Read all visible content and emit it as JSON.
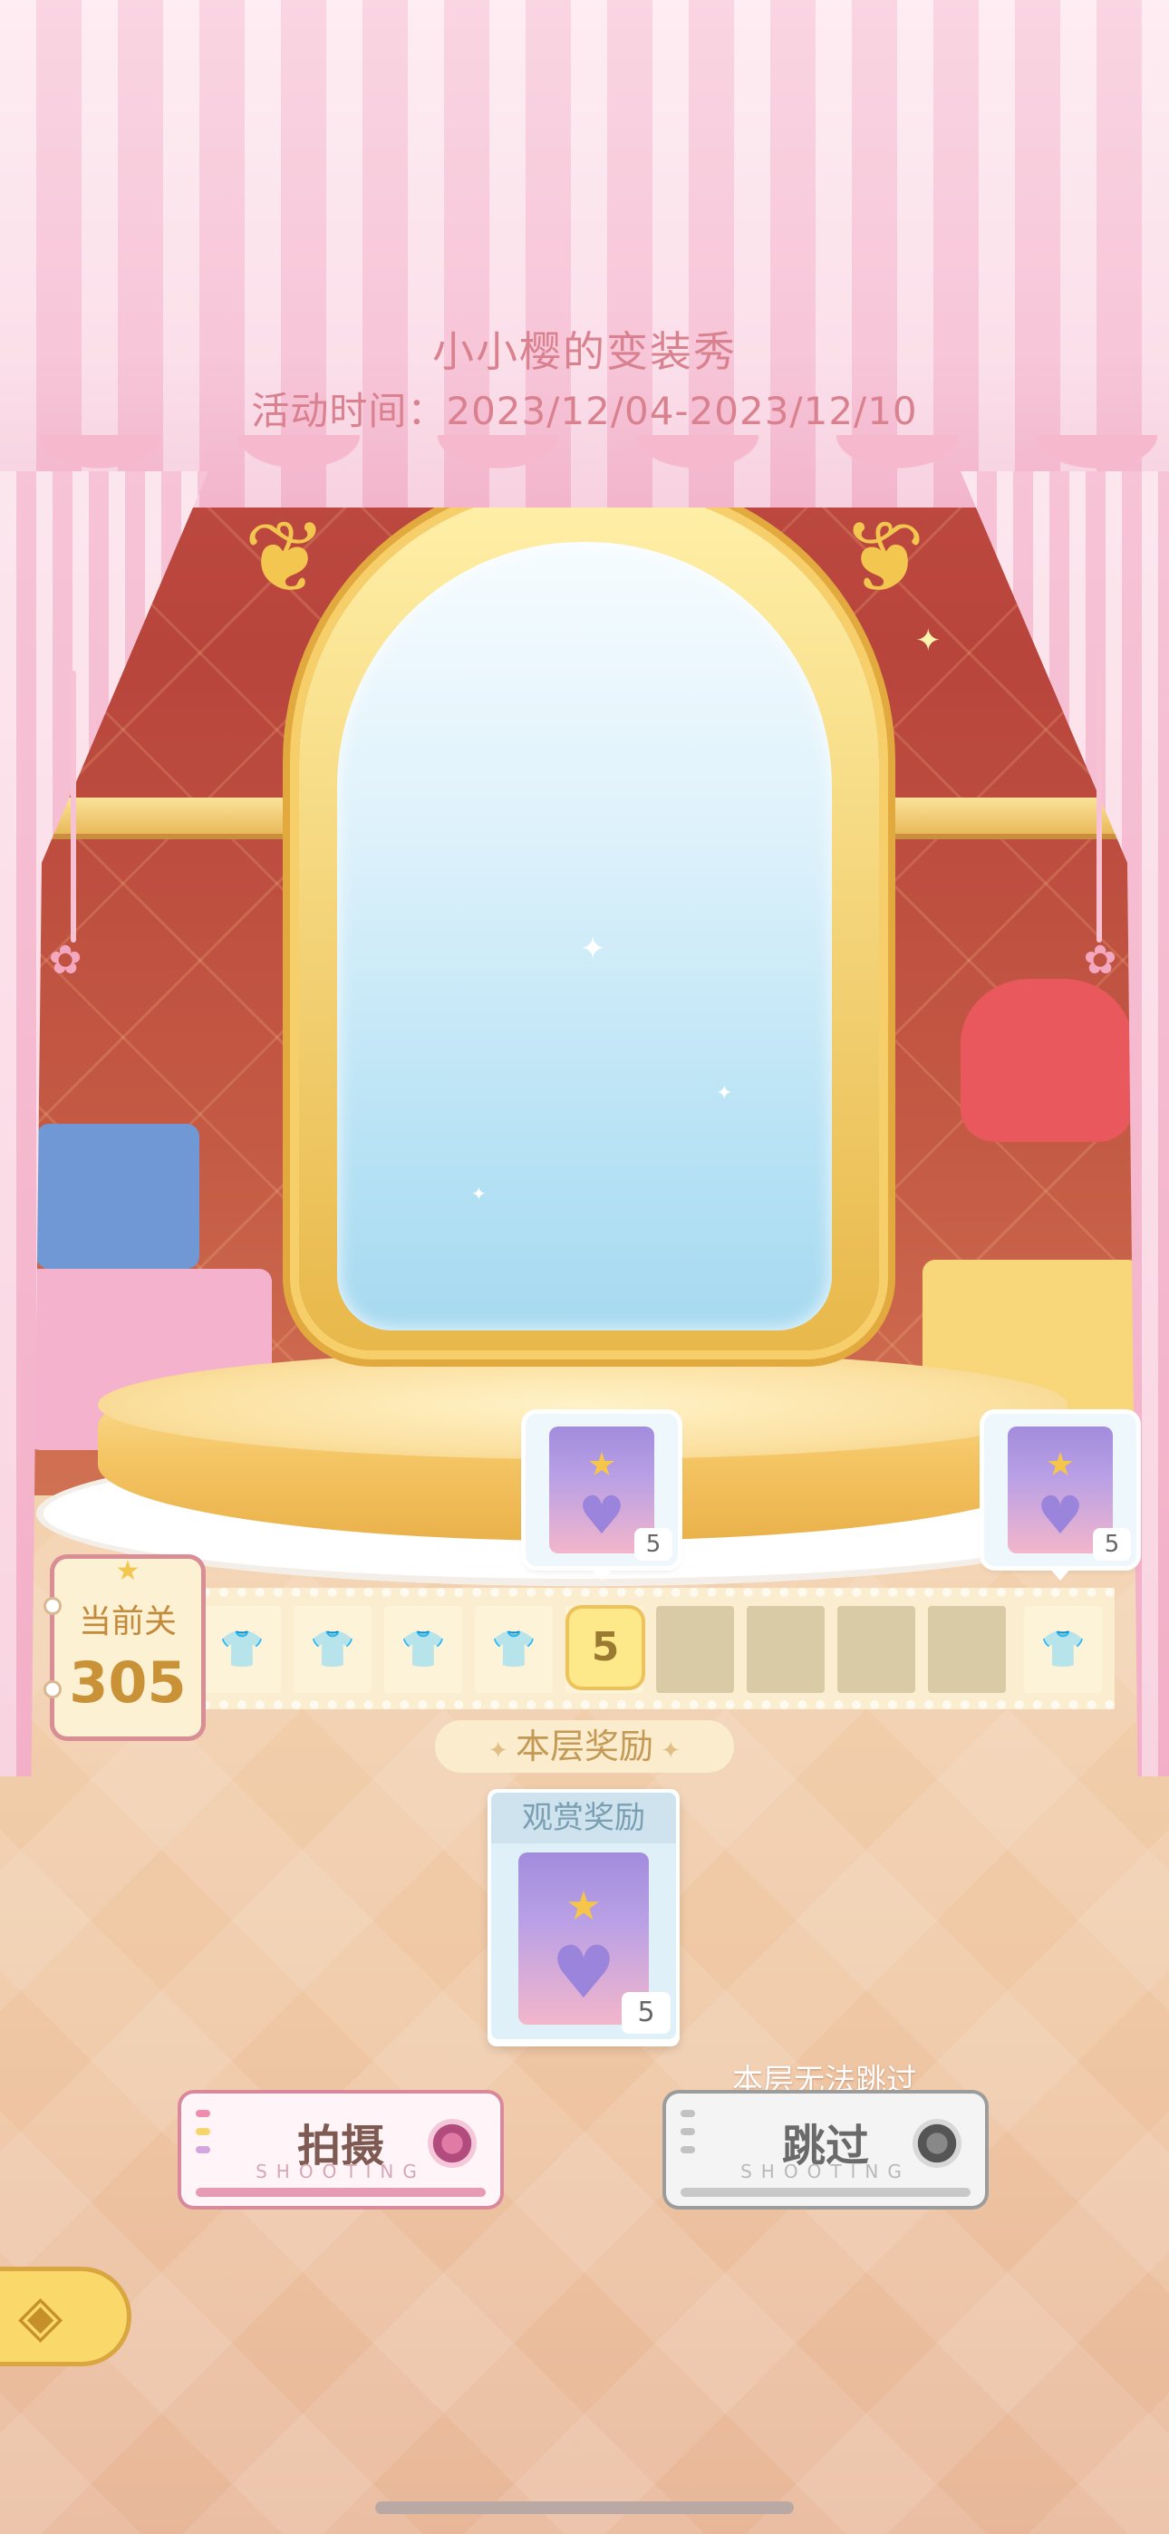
{
  "header": {
    "title": "小小樱的变装秀",
    "event_time": "活动时间：2023/12/04-2023/12/10"
  },
  "level": {
    "label": "当前关",
    "number": "305",
    "star_icon": "star-icon"
  },
  "progress_strip": {
    "current_slot_label": "5",
    "slots": [
      "done",
      "done",
      "done",
      "done",
      "current",
      "todo",
      "todo",
      "todo",
      "todo",
      "done"
    ],
    "mini_rewards": [
      {
        "item_icon": "purple-heart-pack-icon",
        "count": "5"
      },
      {
        "item_icon": "purple-heart-pack-icon",
        "count": "5"
      }
    ]
  },
  "rewards": {
    "section_title": "本层奖励",
    "card_title": "观赏奖励",
    "item_icon": "purple-heart-pack-icon",
    "count": "5"
  },
  "actions": {
    "skip_note": "本层无法跳过",
    "shoot_label": "拍摄",
    "shoot_sub": "SHOOTING",
    "skip_label": "跳过",
    "skip_sub": "SHOOTING"
  },
  "colors": {
    "title_text": "#d9818f",
    "strip_done": "#fdf3d9",
    "strip_todo": "#d9cba5",
    "current_badge": "#fde88a",
    "back_button": "#fbd86a"
  },
  "icons": {
    "back": "back-arrow-icon",
    "shirt": "shirt-icon"
  }
}
